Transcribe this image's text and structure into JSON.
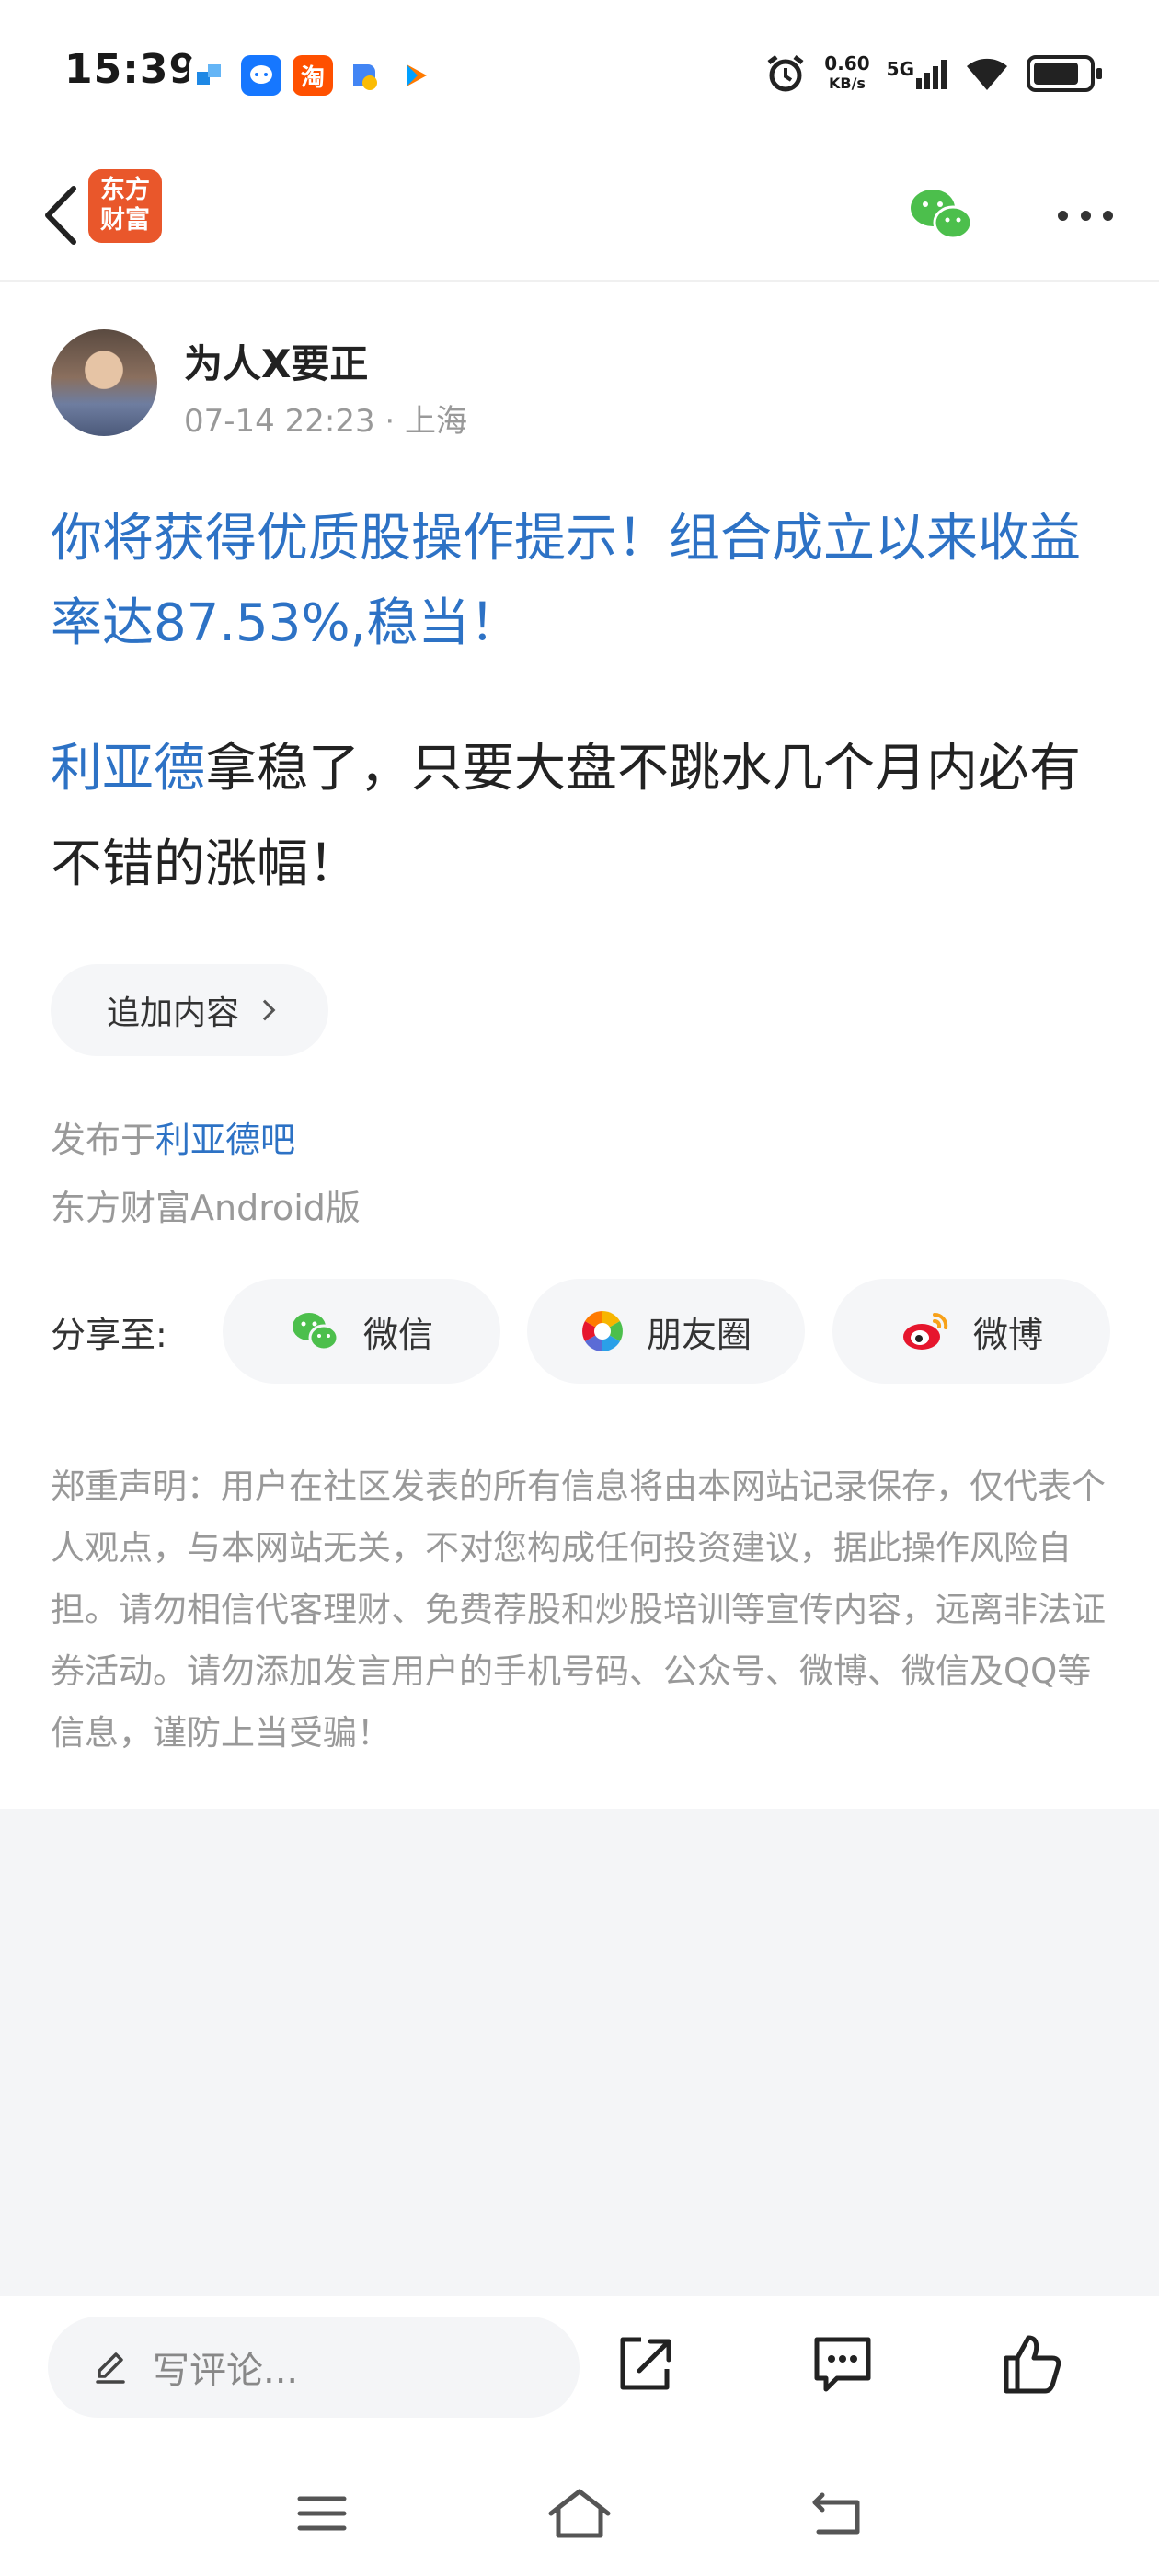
{
  "status_bar": {
    "time": "15:39",
    "net_speed_value": "0.60",
    "net_speed_unit": "KB/s",
    "signal_label": "5G",
    "notification_icons": [
      "blue-app-icon",
      "chat-app-icon",
      "taobao-icon",
      "doc-app-icon",
      "video-app-icon"
    ],
    "taobao_glyph": "淘"
  },
  "app_bar": {
    "logo_text_line1": "东方",
    "logo_text_line2": "财富",
    "logo_color": "#e9572b"
  },
  "post": {
    "author_name": "为人X要正",
    "timestamp": "07-14 22:23",
    "separator": "·",
    "location": "上海",
    "title": "你将获得优质股操作提示！组合成立以来收益率达87.53%,稳当！",
    "body_stock_link": "利亚德",
    "body_text": "拿稳了，只要大盘不跳水几个月内必有不错的涨幅！",
    "append_label": "追加内容",
    "published_prefix": "发布于",
    "published_bar": "利亚德吧",
    "client": "东方财富Android版",
    "link_color": "#2d72c5"
  },
  "share": {
    "label": "分享至:",
    "wechat": "微信",
    "moments": "朋友圈",
    "weibo": "微博"
  },
  "disclaimer": "郑重声明：用户在社区发表的所有信息将由本网站记录保存，仅代表个人观点，与本网站无关，不对您构成任何投资建议，据此操作风险自担。请勿相信代客理财、免费荐股和炒股培训等宣传内容，远离非法证券活动。请勿添加发言用户的手机号码、公众号、微博、微信及QQ等信息，谨防上当受骗！",
  "bottom_bar": {
    "comment_placeholder": "写评论..."
  },
  "colors": {
    "wechat_green": "#4cbf4c",
    "weibo_red": "#e6162d"
  }
}
